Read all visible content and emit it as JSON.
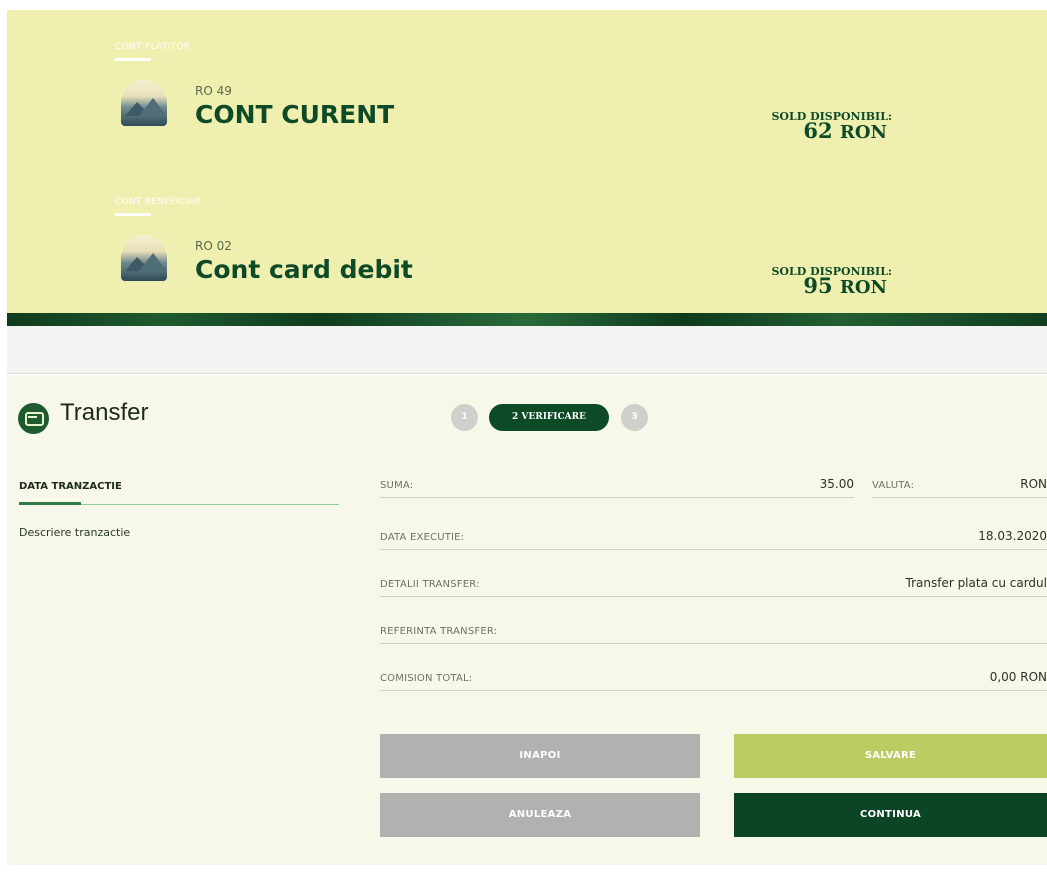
{
  "payer": {
    "section_label": "CONT PLATITOR",
    "iban": "RO 49",
    "name": "CONT CURENT",
    "sold_label": "SOLD DISPONIBIL:",
    "sold_amount": "62",
    "sold_currency": "RON"
  },
  "beneficiary": {
    "section_label": "CONT BENEFICIAR",
    "iban": "RO 02",
    "name": "Cont card debit",
    "sold_label": "SOLD DISPONIBIL:",
    "sold_amount": "95",
    "sold_currency": "RON"
  },
  "page": {
    "title": "Transfer",
    "icon": "transfer-icon"
  },
  "steps": {
    "step1": "1",
    "step2": "2 VERIFICARE",
    "step3": "3",
    "current": 2
  },
  "sidebar": {
    "heading": "DATA TRANZACTIE",
    "description": "Descriere tranzactie"
  },
  "details": {
    "suma_label": "SUMA:",
    "suma_value": "35.00",
    "valuta_label": "VALUTA:",
    "valuta_value": "RON",
    "data_label": "DATA EXECUTIE:",
    "data_value": "18.03.2020",
    "detalii_label": "DETALII TRANSFER:",
    "detalii_value": "Transfer plata cu cardul",
    "referinta_label": "REFERINTA TRANSFER:",
    "referinta_value": "",
    "comision_label": "COMISION TOTAL:",
    "comision_value": "0,00 RON"
  },
  "buttons": {
    "back": "INAPOI",
    "save": "SALVARE",
    "cancel": "ANULEAZA",
    "continue": "CONTINUA"
  },
  "colors": {
    "header_bg": "#eff0b0",
    "primary_dark": "#0c4525",
    "save_green": "#bccc63",
    "neutral_button": "#b1b1b0"
  }
}
